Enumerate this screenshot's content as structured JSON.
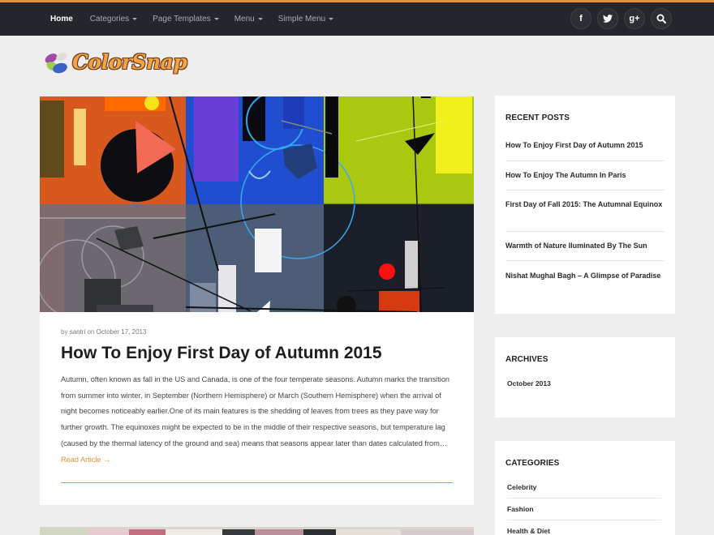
{
  "nav": {
    "items": [
      {
        "label": "Home",
        "active": true
      },
      {
        "label": "Categories",
        "dropdown": true
      },
      {
        "label": "Page Templates",
        "dropdown": true
      },
      {
        "label": "Menu",
        "dropdown": true
      },
      {
        "label": "Simple Menu",
        "dropdown": true
      }
    ],
    "social": [
      {
        "icon": "facebook-icon",
        "glyph": "f"
      },
      {
        "icon": "twitter-icon",
        "glyph": "t"
      },
      {
        "icon": "google-plus-icon",
        "glyph": "g+"
      },
      {
        "icon": "search-icon",
        "glyph": "⌕"
      }
    ]
  },
  "logo": {
    "text": "ColorSnap"
  },
  "post": {
    "meta_by": "by",
    "author": "santri",
    "meta_on": "on",
    "date": "October 17, 2013",
    "title": "How To Enjoy First Day of Autumn 2015",
    "excerpt": "Autumn, often known as fall in the US and Canada, is one of the four temperate seasons. Autumn marks the transition from summer into winter, in September (Northern Hemisphere) or March (Southern Hemisphere) when the arrival of night becomes noticeably earlier.One of its main features is the shedding of leaves from trees as they pave way for further growth. The equinoxes might be expected to be in the middle of their respective seasons, but temperature lag (caused by the thermal latency of the ground and sea) means that seasons appear later than dates calculated from…",
    "read_more": "Read Article →"
  },
  "sidebar": {
    "recent_posts": {
      "title": "RECENT POSTS",
      "items": [
        "How To Enjoy First Day of Autumn 2015",
        "How To Enjoy The Autumn In Paris",
        "First Day of Fall 2015: The Autumnal Equinox",
        "Warmth of Nature Iluminated By The Sun",
        "Nishat Mughal Bagh – A Glimpse of Paradise"
      ]
    },
    "archives": {
      "title": "ARCHIVES",
      "items": [
        "October 2013"
      ]
    },
    "categories": {
      "title": "CATEGORIES",
      "items": [
        "Celebrity",
        "Fashion",
        "Health & Diet"
      ]
    }
  },
  "colors": {
    "accent": "#e8903a",
    "topbar": "#23272b",
    "background": "#eeeeee"
  }
}
